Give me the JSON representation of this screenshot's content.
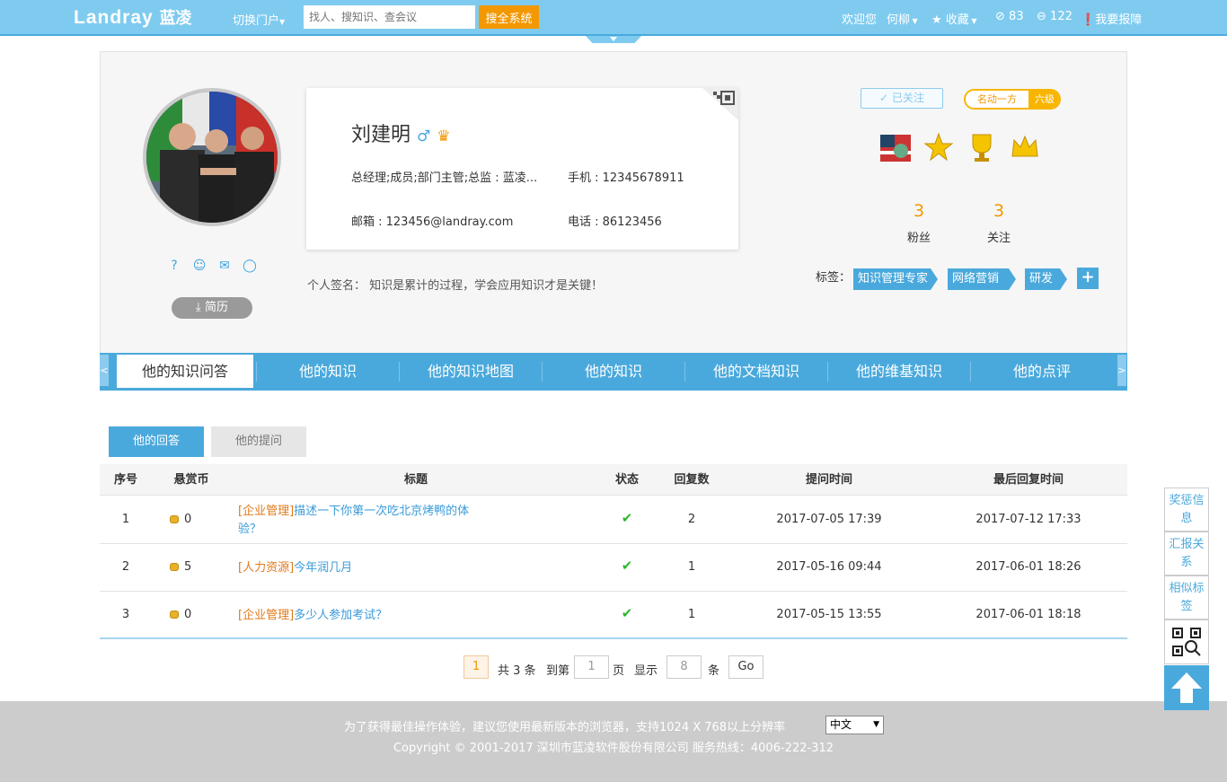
{
  "header": {
    "logo_en": "Landray",
    "logo_cn": "蓝凌",
    "portal_switch": "切换门户",
    "search_placeholder": "找人、搜知识、查会议",
    "search_button": "搜全系统",
    "welcome": "欢迎您",
    "user_name": "何柳",
    "favorites": "收藏",
    "count_a": "83",
    "count_b": "122",
    "report": "我要报障"
  },
  "profile": {
    "name": "刘建明",
    "gender_symbol": "♂",
    "position_info": "总经理;成员;部门主管;总监 : 蓝凌...",
    "mobile_label": "手机 : 12345678911",
    "email_label": "邮箱 : 123456@landray.com",
    "phone_label": "电话 : 86123456",
    "signature_label": "个人签名：",
    "signature": "知识是累计的过程，学会应用知识才是关键！",
    "resume_button": "简历",
    "follow_status": "已关注",
    "level_title": "名动一方",
    "level_grade": "六级",
    "fans_count": "3",
    "fans_label": "粉丝",
    "following_count": "3",
    "following_label": "关注",
    "tags_label": "标签：",
    "tags": [
      "知识管理专家",
      "网络营销",
      "研发"
    ],
    "add_tag": "+"
  },
  "nav": {
    "prev": "<",
    "next": ">",
    "items": [
      "他的知识问答",
      "他的知识",
      "他的知识地图",
      "他的知识",
      "他的文档知识",
      "他的维基知识",
      "他的点评"
    ],
    "active_index": 0
  },
  "subtabs": {
    "answers": "他的回答",
    "questions": "他的提问"
  },
  "table": {
    "headers": [
      "序号",
      "悬赏币",
      "标题",
      "状态",
      "回复数",
      "提问时间",
      "最后回复时间"
    ],
    "rows": [
      {
        "no": "1",
        "reward": "0",
        "category": "[企业管理]",
        "title": "描述一下你第一次吃北京烤鸭的体验？",
        "status": "✔",
        "replies": "2",
        "asked": "2017-07-05 17:39",
        "last_reply": "2017-07-12 17:33"
      },
      {
        "no": "2",
        "reward": "5",
        "category": "[人力资源]",
        "title": "今年润几月",
        "status": "✔",
        "replies": "1",
        "asked": "2017-05-16 09:44",
        "last_reply": "2017-06-01 18:26"
      },
      {
        "no": "3",
        "reward": "0",
        "category": "[企业管理]",
        "title": "多少人参加考试？",
        "status": "✔",
        "replies": "1",
        "asked": "2017-05-15 13:55",
        "last_reply": "2017-06-01 18:18"
      }
    ]
  },
  "pager": {
    "current": "1",
    "total_text": "共 3 条",
    "goto_label": "到第",
    "goto_value": "1",
    "page_unit": "页",
    "show_label": "显示",
    "page_size": "8",
    "size_unit": "条",
    "go_button": "Go"
  },
  "footer": {
    "notice": "为了获得最佳操作体验，建议您使用最新版本的浏览器，支持1024 X 768以上分辨率",
    "language": "中文",
    "copyright": "Copyright © 2001-2017 深圳市蓝凌软件股份有限公司 服务热线：4006-222-312"
  },
  "sidebar": {
    "rewards": "奖惩信息",
    "report_relation": "汇报关系",
    "similar_tags": "相似标签"
  },
  "colors": {
    "header_bg": "#7fcbf0",
    "accent": "#4aa9dc",
    "orange": "#f39800"
  }
}
